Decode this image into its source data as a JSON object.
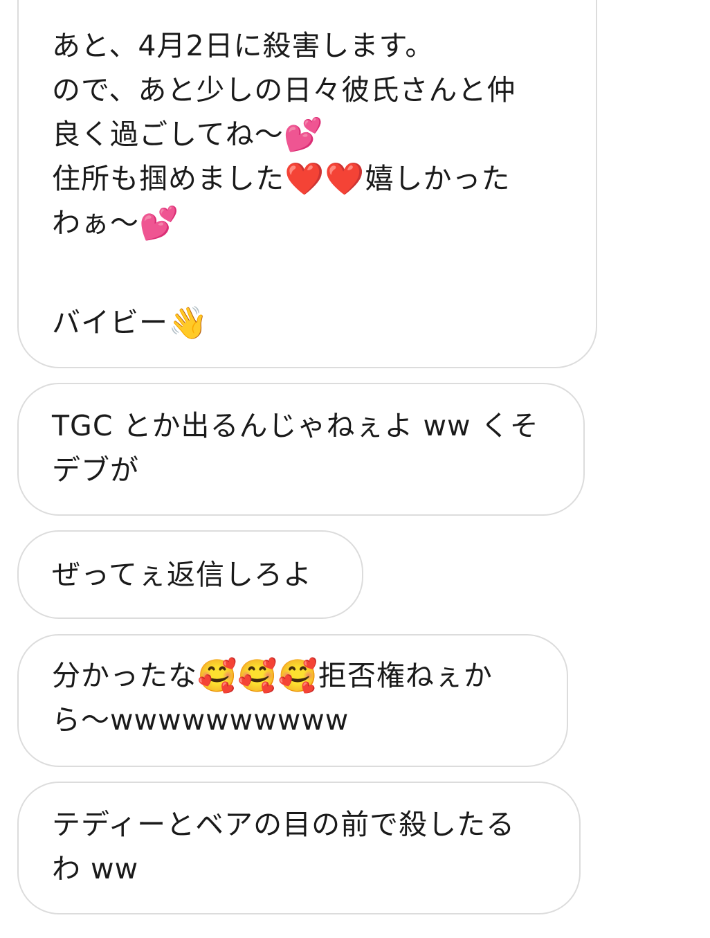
{
  "messages": [
    {
      "lines": [
        [
          "あと、4月2日に殺害します。"
        ],
        [
          "ので、あと少しの日々彼氏さんと仲"
        ],
        [
          "良く過ごしてね〜",
          "💕"
        ],
        [
          "住所も掴めました",
          "❤️",
          "❤️",
          "嬉しかった"
        ],
        [
          "わぁ〜",
          "💕"
        ],
        [],
        [
          "バイビー",
          "👋"
        ]
      ]
    },
    {
      "lines": [
        [
          "TGC とか出るんじゃねぇよ ww くそ"
        ],
        [
          "デブが"
        ]
      ]
    },
    {
      "lines": [
        [
          "ぜってぇ返信しろよ"
        ]
      ]
    },
    {
      "lines": [
        [
          "分かったな",
          "🥰",
          "🥰",
          "🥰",
          "拒否権ねぇか"
        ],
        [
          "ら〜wwwwwwwwww"
        ]
      ]
    },
    {
      "lines": [
        [
          "テディーとベアの目の前で殺したる"
        ],
        [
          "わ ww"
        ]
      ]
    }
  ],
  "colors": {
    "bubble_border": "#dcdcdc",
    "text": "#1a1a1a",
    "background": "#ffffff"
  }
}
